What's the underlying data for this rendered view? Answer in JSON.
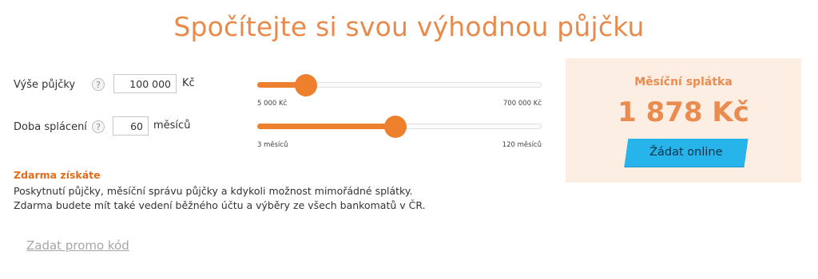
{
  "title": "Spočítejte si svou výhodnou půjčku",
  "amount": {
    "label": "Výše půjčky",
    "help": "?",
    "value": "100 000",
    "unit": "Kč",
    "min_label": "5 000 Kč",
    "max_label": "700 000 Kč",
    "min": 5000,
    "max": 700000,
    "current": 100000,
    "slider_fraction": 0.17
  },
  "duration": {
    "label": "Doba splácení",
    "help": "?",
    "value": "60",
    "unit": "měsíců",
    "min_label": "3 měsíců",
    "max_label": "120 měsíců",
    "min": 3,
    "max": 120,
    "current": 60,
    "slider_fraction": 0.487
  },
  "free": {
    "title": "Zdarma získáte",
    "line1": "Poskytnutí půjčky, měsíční správu půjčky a kdykoli možnost mimořádné splátky.",
    "line2": "Zdarma budete mít také vedení běžného účtu a výběry ze všech bankomatů v ČR."
  },
  "promo_label": "Zadat promo kód",
  "result": {
    "label": "Měsíční splátka",
    "value": "1 878 Kč",
    "button": "Žádat online"
  },
  "colors": {
    "accent": "#ee7f2d",
    "title": "#e98a4b",
    "result_bg": "#fdeee4",
    "button": "#26b4ea"
  }
}
